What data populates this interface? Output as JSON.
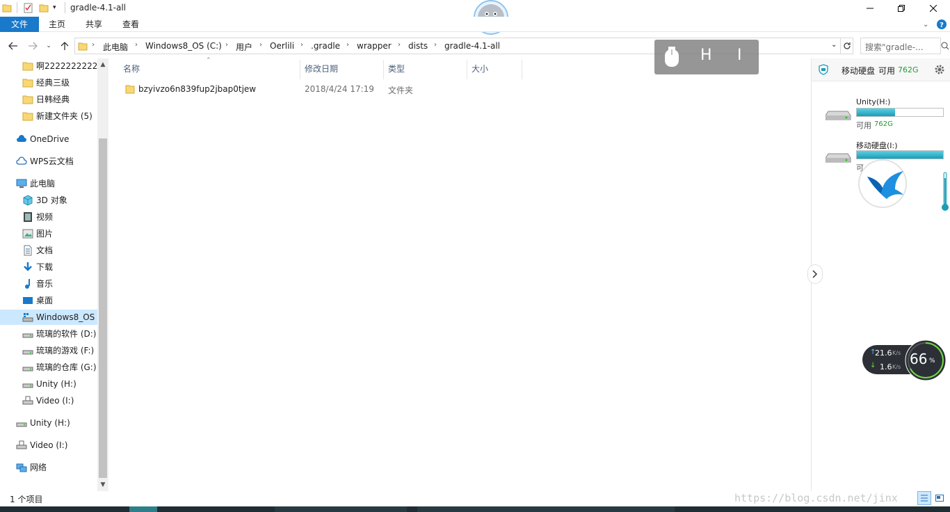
{
  "window": {
    "title": "gradle-4.1-all"
  },
  "ribbon": {
    "tabs": [
      {
        "label": "文件"
      },
      {
        "label": "主页"
      },
      {
        "label": "共享"
      },
      {
        "label": "查看"
      }
    ]
  },
  "address": {
    "crumbs": [
      "此电脑",
      "Windows8_OS (C:)",
      "用户",
      "Oerlili",
      ".gradle",
      "wrapper",
      "dists",
      "gradle-4.1-all"
    ],
    "search_placeholder": "搜索\"gradle-..."
  },
  "navpane": {
    "items": [
      {
        "label": "啊2222222222",
        "icon": "folder-icon"
      },
      {
        "label": "经典三级",
        "icon": "folder-icon"
      },
      {
        "label": "日韩经典",
        "icon": "folder-icon"
      },
      {
        "label": "新建文件夹 (5)",
        "icon": "folder-icon"
      },
      {
        "label": "OneDrive",
        "icon": "cloud-icon"
      },
      {
        "label": "WPS云文档",
        "icon": "wps-cloud-icon"
      },
      {
        "label": "此电脑",
        "icon": "computer-icon"
      },
      {
        "label": "3D 对象",
        "icon": "cube-icon"
      },
      {
        "label": "视频",
        "icon": "video-icon"
      },
      {
        "label": "图片",
        "icon": "picture-icon"
      },
      {
        "label": "文档",
        "icon": "document-icon"
      },
      {
        "label": "下载",
        "icon": "download-icon"
      },
      {
        "label": "音乐",
        "icon": "music-icon"
      },
      {
        "label": "桌面",
        "icon": "desktop-icon"
      },
      {
        "label": "Windows8_OS",
        "icon": "system-drive-icon"
      },
      {
        "label": "琉璃的软件 (D:)",
        "icon": "drive-icon"
      },
      {
        "label": "琉璃的游戏 (F:)",
        "icon": "drive-icon"
      },
      {
        "label": "琉璃的仓库 (G:)",
        "icon": "drive-icon"
      },
      {
        "label": "Unity (H:)",
        "icon": "drive-icon"
      },
      {
        "label": "Video (I:)",
        "icon": "usb-drive-icon"
      },
      {
        "label": "Unity (H:)",
        "icon": "drive-icon"
      },
      {
        "label": "Video (I:)",
        "icon": "usb-drive-icon"
      },
      {
        "label": "网络",
        "icon": "network-icon"
      }
    ]
  },
  "list": {
    "columns": [
      "名称",
      "修改日期",
      "类型",
      "大小"
    ],
    "rows": [
      {
        "name": "bzyivzo6n839fup2jbap0tjew",
        "date": "2018/4/24 17:19",
        "type": "文件夹",
        "size": ""
      }
    ]
  },
  "status": {
    "count": "1 个项目",
    "watermark": "https://blog.csdn.net/jinx"
  },
  "sidepanel": {
    "header_title": "移动硬盘",
    "header_free_label": "可用",
    "header_free_value": "762G",
    "drives": [
      {
        "name": "Unity(H:)",
        "free_label": "可用",
        "free_value": "762G",
        "used_fraction": 0.44
      },
      {
        "name": "移动硬盘(I:)",
        "free_label": "可",
        "free_value": "",
        "used_fraction": 1.0
      }
    ]
  },
  "hi_widget": {
    "letters": [
      "H",
      "I"
    ]
  },
  "speed": {
    "upload": "21.6",
    "download": "1.6",
    "unit": "K/s",
    "percent": "66",
    "percent_sign": "%"
  },
  "colors": {
    "accent": "#1979ca",
    "selected": "#cce8ff",
    "folder": "#f8d775",
    "disk_bar": "#1a9db6"
  }
}
